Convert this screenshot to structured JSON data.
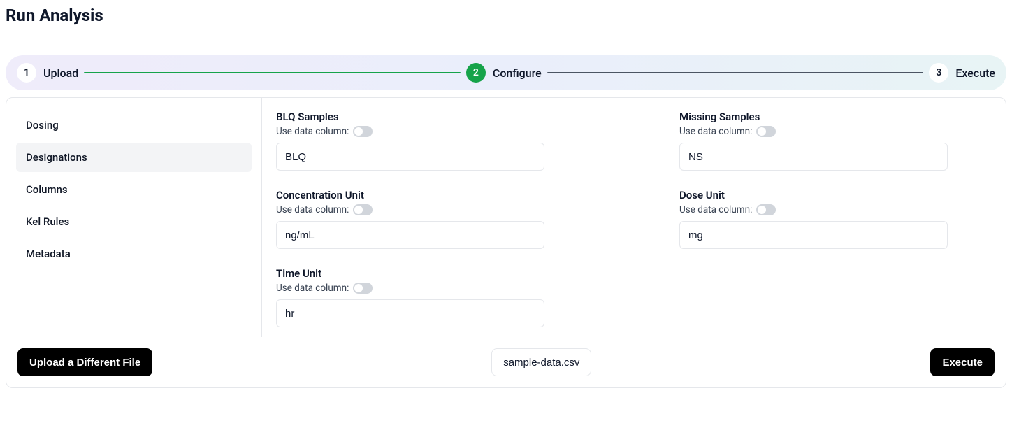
{
  "title": "Run Analysis",
  "stepper": {
    "steps": [
      {
        "num": "1",
        "label": "Upload",
        "active": false
      },
      {
        "num": "2",
        "label": "Configure",
        "active": true
      },
      {
        "num": "3",
        "label": "Execute",
        "active": false
      }
    ]
  },
  "sidebar": {
    "items": [
      {
        "label": "Dosing",
        "active": false
      },
      {
        "label": "Designations",
        "active": true
      },
      {
        "label": "Columns",
        "active": false
      },
      {
        "label": "Kel Rules",
        "active": false
      },
      {
        "label": "Metadata",
        "active": false
      }
    ]
  },
  "form": {
    "toggle_label": "Use data column:",
    "fields": {
      "blq": {
        "label": "BLQ Samples",
        "value": "BLQ"
      },
      "missing": {
        "label": "Missing Samples",
        "value": "NS"
      },
      "conc": {
        "label": "Concentration Unit",
        "value": "ng/mL"
      },
      "dose": {
        "label": "Dose Unit",
        "value": "mg"
      },
      "time": {
        "label": "Time Unit",
        "value": "hr"
      }
    }
  },
  "footer": {
    "upload_btn": "Upload a Different File",
    "filename": "sample-data.csv",
    "execute_btn": "Execute"
  }
}
